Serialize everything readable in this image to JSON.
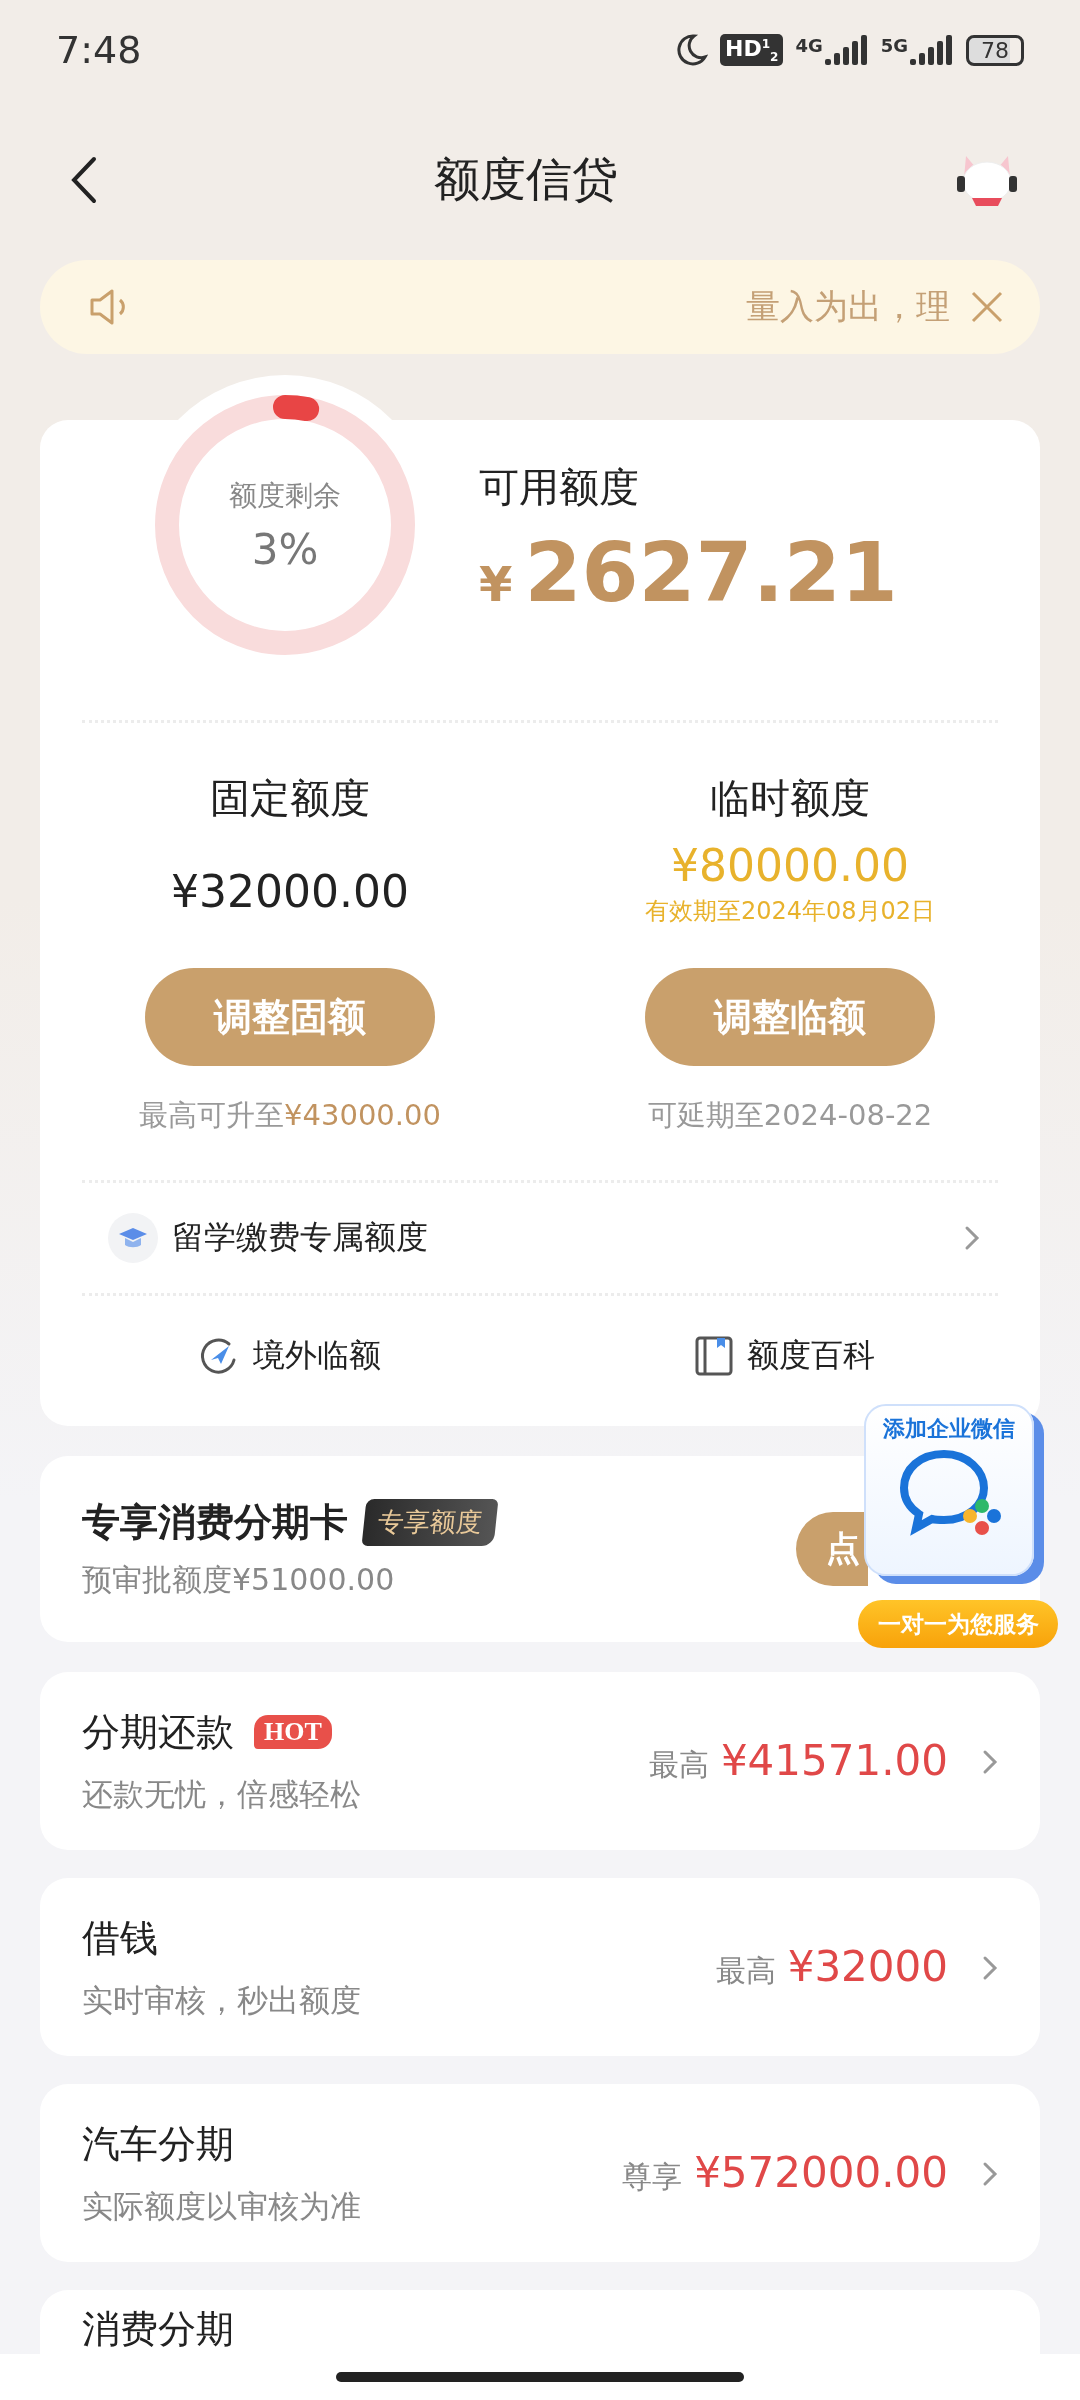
{
  "status_bar": {
    "time": "7:48",
    "hd_badge": "HD$^{1}$$_{2}$",
    "network_1": "4G",
    "network_2": "5G",
    "battery": "78"
  },
  "header": {
    "title": "额度信贷"
  },
  "notice": {
    "text": "量入为出，理"
  },
  "credit": {
    "ring_label": "额度剩余",
    "ring_value": "3%",
    "level": 0.03,
    "available_label": "可用额度",
    "currency": "¥",
    "amount": "2627.21"
  },
  "limits": [
    {
      "kind": "fixed",
      "title": "固定额度",
      "amount": "¥32000.00",
      "button": "调整固额",
      "note": "最高可升至",
      "note_highlight": "¥43000.00"
    },
    {
      "kind": "temporary",
      "title": "临时额度",
      "amount": "¥80000.00",
      "validity": "有效期至2024年08月02日",
      "button": "调整临额",
      "note": "可延期至2024-08-22"
    }
  ],
  "study_row": {
    "label": "留学缴费专属额度"
  },
  "quick_links": [
    {
      "kind": "overseas",
      "label": "境外临额"
    },
    {
      "kind": "wiki",
      "label": "额度百科"
    }
  ],
  "installment_card": {
    "title": "专享消费分期卡",
    "tag": "专享额度",
    "subtitle": "预审批额度¥51000.00",
    "button": "点"
  },
  "wecom_widget": {
    "title": "添加企业微信",
    "caption": "一对一为您服务"
  },
  "products": [
    {
      "title": "分期还款",
      "badge": "HOT",
      "subtitle": "还款无忧，倍感轻松",
      "prefix": "最高",
      "amount": "¥41571.00"
    },
    {
      "title": "借钱",
      "subtitle": "实时审核，秒出额度",
      "prefix": "最高",
      "amount": "¥32000"
    },
    {
      "title": "汽车分期",
      "subtitle": "实际额度以审核为准",
      "prefix": "尊享",
      "amount": "¥572000.00"
    },
    {
      "title": "消费分期"
    }
  ]
}
